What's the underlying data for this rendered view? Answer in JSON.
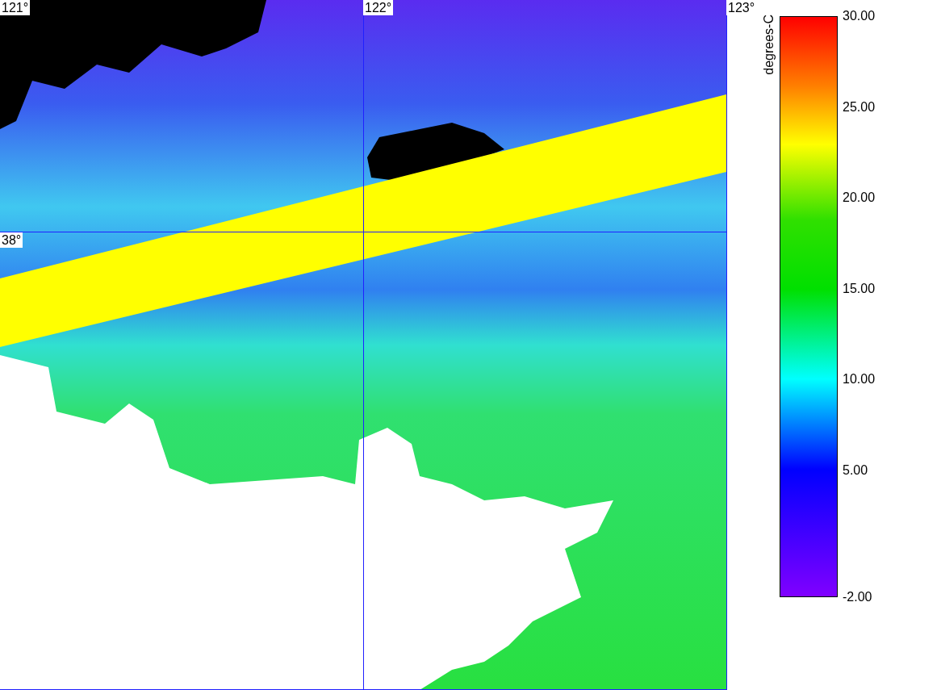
{
  "map": {
    "longitude_labels": [
      "121°",
      "122°",
      "123°"
    ],
    "latitude_labels": [
      "38°"
    ]
  },
  "colorbar": {
    "title": "degrees-C",
    "ticks": [
      "30.00",
      "25.00",
      "20.00",
      "15.00",
      "10.00",
      "5.00",
      "-2.00"
    ]
  }
}
